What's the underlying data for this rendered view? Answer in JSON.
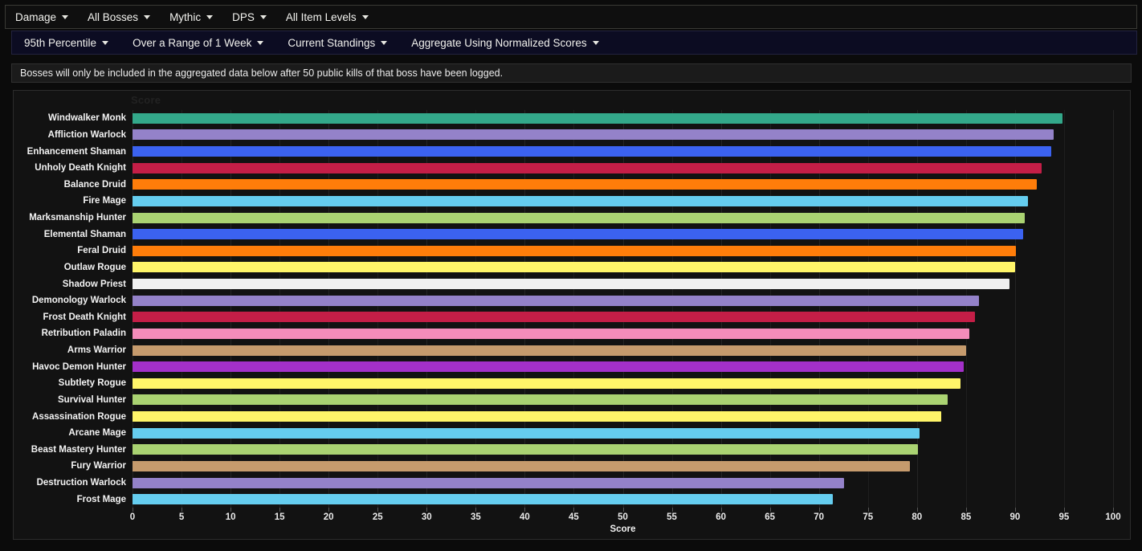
{
  "toolbars": {
    "primary": [
      {
        "label": "Damage",
        "name": "menu-damage"
      },
      {
        "label": "All Bosses",
        "name": "menu-all-bosses"
      },
      {
        "label": "Mythic",
        "name": "menu-mythic"
      },
      {
        "label": "DPS",
        "name": "menu-dps"
      },
      {
        "label": "All Item Levels",
        "name": "menu-all-item-levels"
      }
    ],
    "secondary": [
      {
        "label": "95th Percentile",
        "name": "menu-95th-percentile"
      },
      {
        "label": "Over a Range of 1 Week",
        "name": "menu-range-1-week"
      },
      {
        "label": "Current Standings",
        "name": "menu-current-standings"
      },
      {
        "label": "Aggregate Using Normalized Scores",
        "name": "menu-aggregate-normalized"
      }
    ]
  },
  "notice": {
    "text": "Bosses will only be included in the aggregated data below after 50 public kills of that boss have been logged."
  },
  "chart_data": {
    "type": "bar",
    "orientation": "horizontal",
    "title": "Score",
    "xlabel": "Score",
    "ylabel": "",
    "xlim": [
      0,
      100
    ],
    "xticks": [
      0,
      5,
      10,
      15,
      20,
      25,
      30,
      35,
      40,
      45,
      50,
      55,
      60,
      65,
      70,
      75,
      80,
      85,
      90,
      95,
      100
    ],
    "grid": true,
    "legend": "none",
    "categories": [
      "Windwalker Monk",
      "Affliction Warlock",
      "Enhancement Shaman",
      "Unholy Death Knight",
      "Balance Druid",
      "Fire Mage",
      "Marksmanship Hunter",
      "Elemental Shaman",
      "Feral Druid",
      "Outlaw Rogue",
      "Shadow Priest",
      "Demonology Warlock",
      "Frost Death Knight",
      "Retribution Paladin",
      "Arms Warrior",
      "Havoc Demon Hunter",
      "Subtlety Rogue",
      "Survival Hunter",
      "Assassination Rogue",
      "Arcane Mage",
      "Beast Mastery Hunter",
      "Fury Warrior",
      "Destruction Warlock",
      "Frost Mage"
    ],
    "values": [
      94.8,
      93.9,
      93.7,
      92.7,
      92.2,
      91.3,
      91.0,
      90.8,
      90.1,
      90.0,
      89.4,
      86.3,
      85.9,
      85.3,
      85.0,
      84.8,
      84.4,
      83.1,
      82.5,
      80.3,
      80.1,
      79.3,
      72.6,
      71.4
    ],
    "colors": [
      "#33A88A",
      "#9482C9",
      "#3B62F0",
      "#C41E47",
      "#FF7D0A",
      "#65CDEF",
      "#AAD372",
      "#3B62F0",
      "#FF7D0A",
      "#FFF569",
      "#F0F0F0",
      "#9482C9",
      "#C41E47",
      "#F48CBA",
      "#C69B6D",
      "#A330C9",
      "#FFF569",
      "#AAD372",
      "#FFF569",
      "#65CDEF",
      "#AAD372",
      "#C69B6D",
      "#9482C9",
      "#65CDEF"
    ]
  }
}
